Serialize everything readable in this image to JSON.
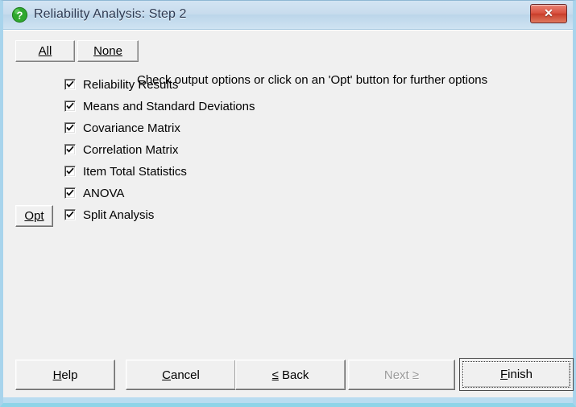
{
  "window": {
    "title": "Reliability Analysis: Step 2",
    "icon": "question-mark-icon",
    "close_label": "✕"
  },
  "toolbar": {
    "all_label": "All",
    "none_label": "None",
    "instruction": "Check output options or click on an 'Opt' button for further options"
  },
  "options": [
    {
      "label": "Reliability Results",
      "checked": true
    },
    {
      "label": "Means and Standard Deviations",
      "checked": true
    },
    {
      "label": "Covariance Matrix",
      "checked": true
    },
    {
      "label": "Correlation Matrix",
      "checked": true
    },
    {
      "label": "Item Total Statistics",
      "checked": true
    },
    {
      "label": "ANOVA",
      "checked": true
    },
    {
      "label": "Split Analysis",
      "checked": true
    }
  ],
  "opt_button": {
    "label": "Opt"
  },
  "footer": {
    "help": {
      "label": "Help",
      "mnemonic": "H",
      "enabled": true
    },
    "cancel": {
      "label": "Cancel",
      "mnemonic": "C",
      "enabled": true
    },
    "back": {
      "label": "< Back",
      "enabled": true
    },
    "next": {
      "label": "Next >",
      "enabled": false
    },
    "finish": {
      "label": "Finish",
      "mnemonic": "F",
      "enabled": true,
      "default": true
    }
  },
  "colors": {
    "dialog_face": "#f0f0f0",
    "frame": "#a8d4ec",
    "title_text": "#2d3a52",
    "close_button": "#d9513f",
    "icon_green": "#2a9c2a",
    "disabled_text": "#9a9a9a"
  }
}
